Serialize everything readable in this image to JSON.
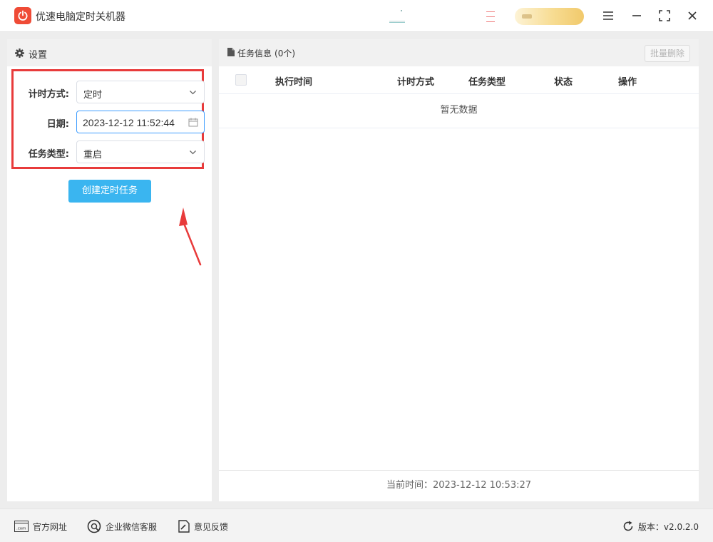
{
  "app": {
    "title": "优速电脑定时关机器",
    "logo_color": "#ef4b36"
  },
  "window_controls": [
    "menu-icon",
    "minimize-icon",
    "maximize-icon",
    "close-icon"
  ],
  "settings": {
    "title": "设置",
    "timing_mode": {
      "label": "计时方式:",
      "value": "定时"
    },
    "date": {
      "label": "日期:",
      "value": "2023-12-12 11:52:44"
    },
    "task_type": {
      "label": "任务类型:",
      "value": "重启"
    },
    "create_button": "创建定时任务"
  },
  "tasks": {
    "title": "任务信息",
    "count": "(0个)",
    "batch_delete": "批量删除",
    "columns": [
      "执行时间",
      "计时方式",
      "任务类型",
      "状态",
      "操作"
    ],
    "empty_text": "暂无数据",
    "current_time": "当前时间：2023-12-12 10:53:27"
  },
  "statusbar": {
    "website": "官方网址",
    "wechat": "企业微信客服",
    "feedback": "意见反馈",
    "version": "版本：v2.0.2.0"
  },
  "colors": {
    "accent_button": "#3ab5f0",
    "highlight_border": "#e83b3b",
    "focus_border": "#409eff",
    "vip_gold": "#f1c96b"
  }
}
